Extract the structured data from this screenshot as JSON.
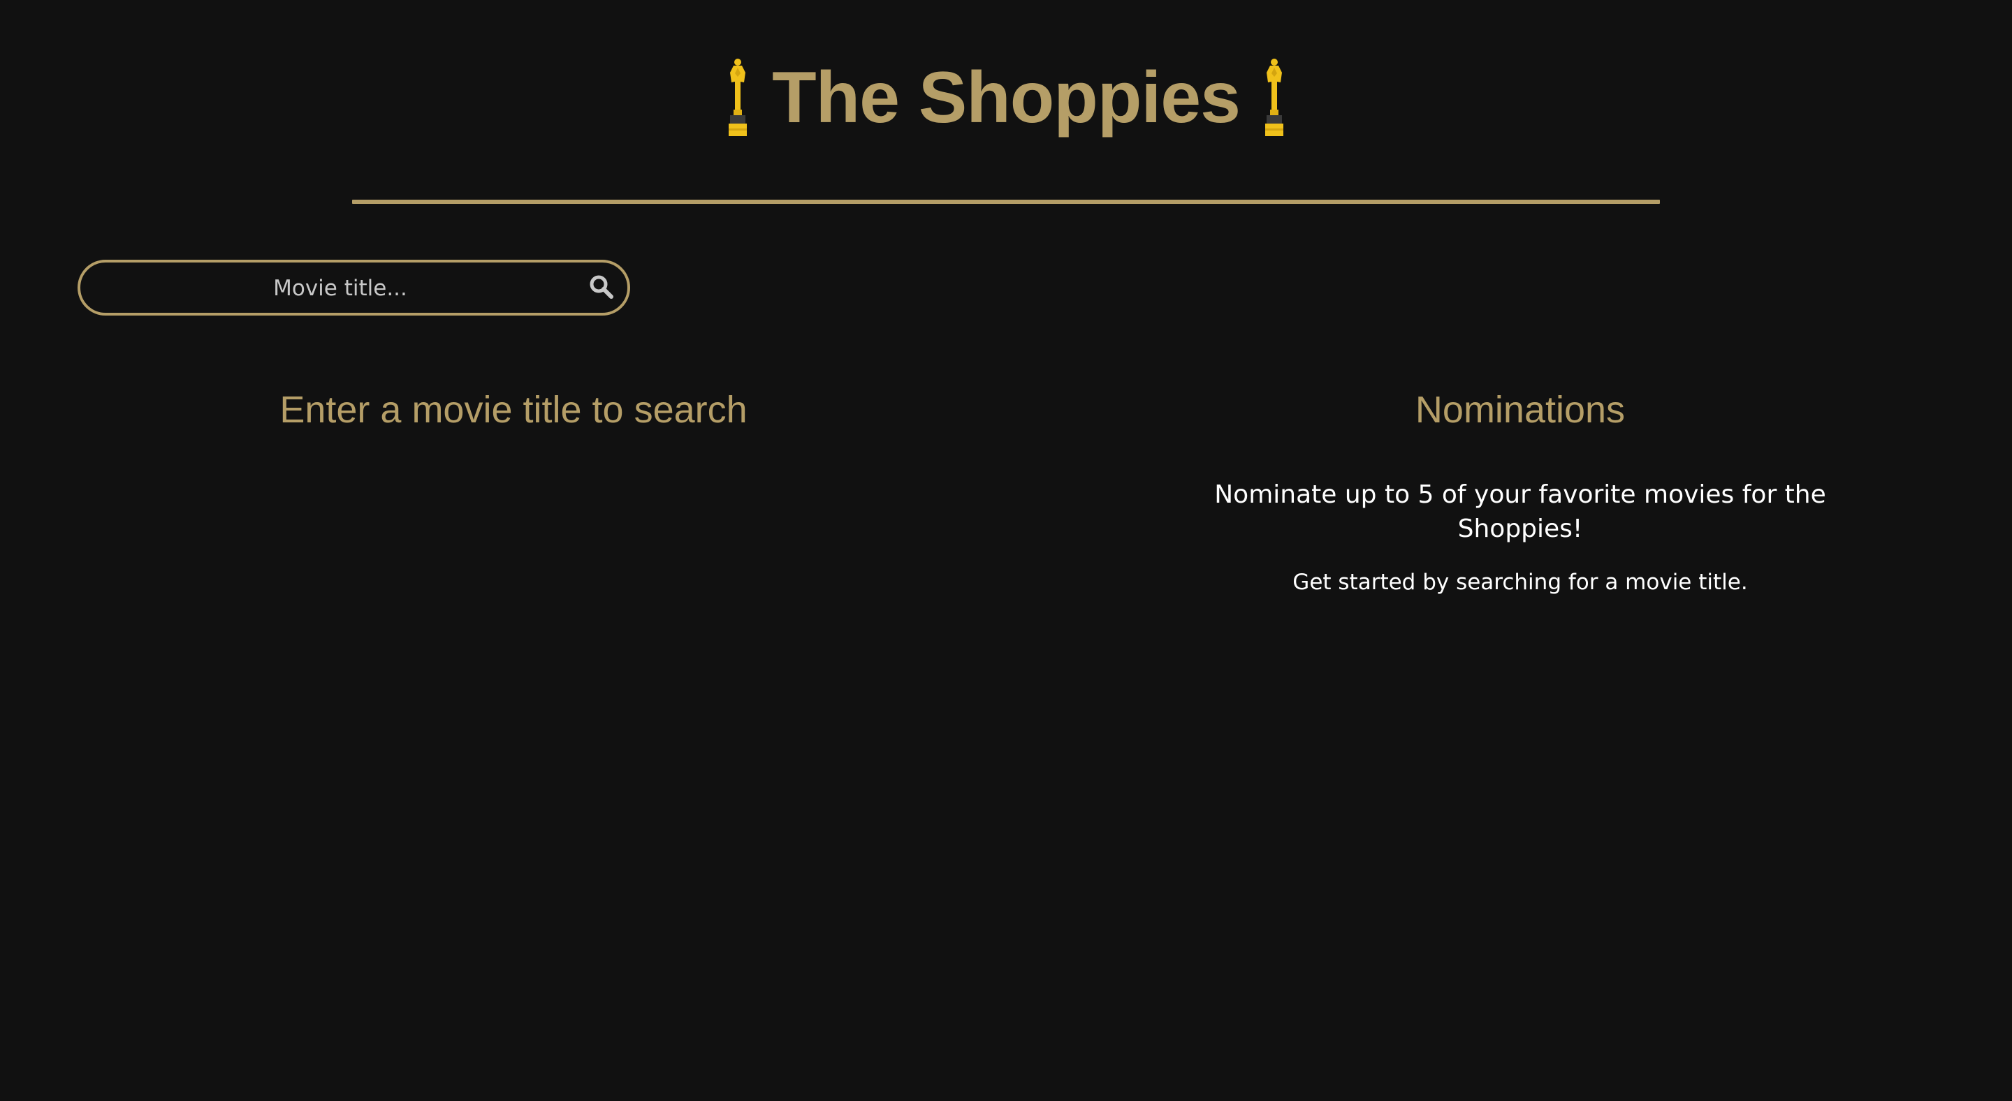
{
  "header": {
    "title": "The Shoppies",
    "left_icon": "trophy-icon",
    "right_icon": "trophy-icon"
  },
  "search": {
    "placeholder": "Movie title...",
    "value": "",
    "icon": "search-icon"
  },
  "results": {
    "heading": "Enter a movie title to search"
  },
  "nominations": {
    "heading": "Nominations",
    "intro": "Nominate up to 5 of your favorite movies for the Shoppies!",
    "hint": "Get started by searching for a movie title."
  },
  "colors": {
    "background": "#111111",
    "accent_gold": "#b59e67",
    "trophy_gold": "#f0c11b",
    "text_white": "#ffffff"
  }
}
